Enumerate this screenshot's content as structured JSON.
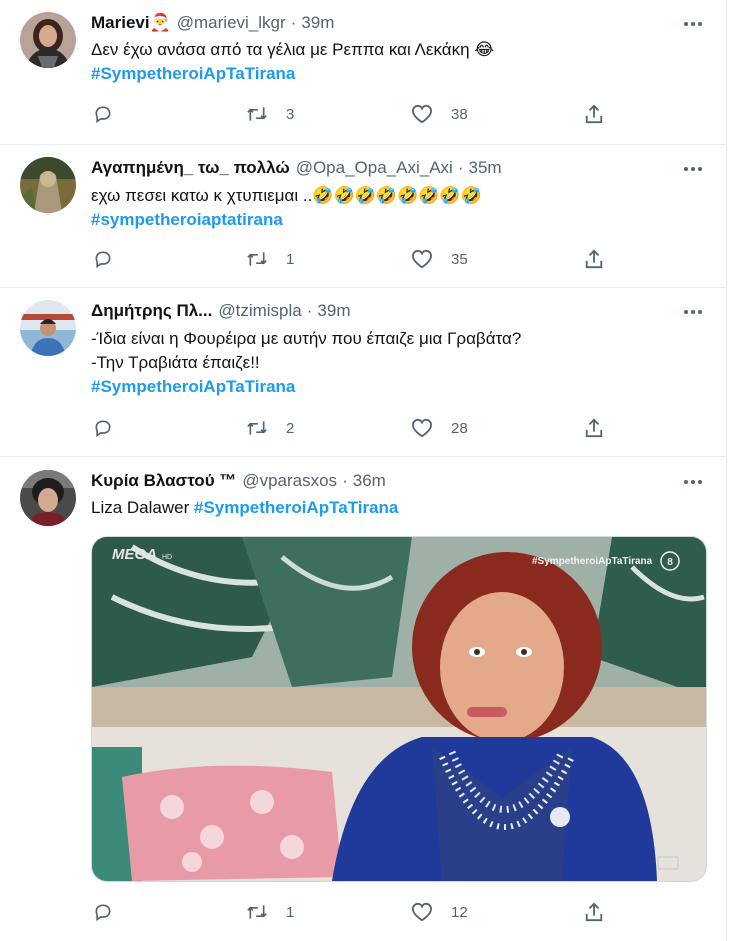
{
  "tweets": [
    {
      "name": "Marievi🎅",
      "handle": "@marievi_lkgr",
      "time": "39m",
      "lines": [
        "Δεν έχω ανάσα από τα γέλια με Ρεππα και Λεκάκη 😂"
      ],
      "hashtag": "#SympetheroiApTaTirana",
      "retweets": "3",
      "likes": "38"
    },
    {
      "name": "Αγαπημένη_ τω_ πολλώ",
      "handle": "@Opa_Opa_Axi_Axi",
      "time": "35m",
      "lines": [
        "εχω πεσει κατω κ χτυπιεμαι ..🤣🤣🤣🤣🤣🤣🤣🤣"
      ],
      "hashtag": "#sympetheroiaptatirana",
      "retweets": "1",
      "likes": "35"
    },
    {
      "name": "Δημήτρης Πλ...",
      "handle": "@tzimispla",
      "time": "39m",
      "lines": [
        "-Ίδια είναι η Φουρέιρα με αυτήν που έπαιζε μια Γραβάτα?",
        "-Την Τραβιάτα έπαιζε!!"
      ],
      "hashtag": "#SympetheroiApTaTirana",
      "retweets": "2",
      "likes": "28"
    },
    {
      "name": "Κυρία Βλαστού ™",
      "handle": "@vparasxos",
      "time": "36m",
      "text_prefix": "Liza Dalawer",
      "hashtag": "#SympetheroiApTaTirana",
      "retweets": "1",
      "likes": "12",
      "media": {
        "channel_logo": "MEGA",
        "channel_logo_sub": "HD",
        "overlay_hashtag": "#SympetheroiApTaTirana",
        "rating_badge": "8"
      }
    }
  ],
  "icons": {
    "reply": "reply-icon",
    "retweet": "retweet-icon",
    "like": "heart-icon",
    "share": "share-icon",
    "more": "more-icon"
  },
  "colors": {
    "hashtag": "#1d9bf0",
    "secondary_text": "#536471",
    "divider": "#e6ecf0"
  }
}
